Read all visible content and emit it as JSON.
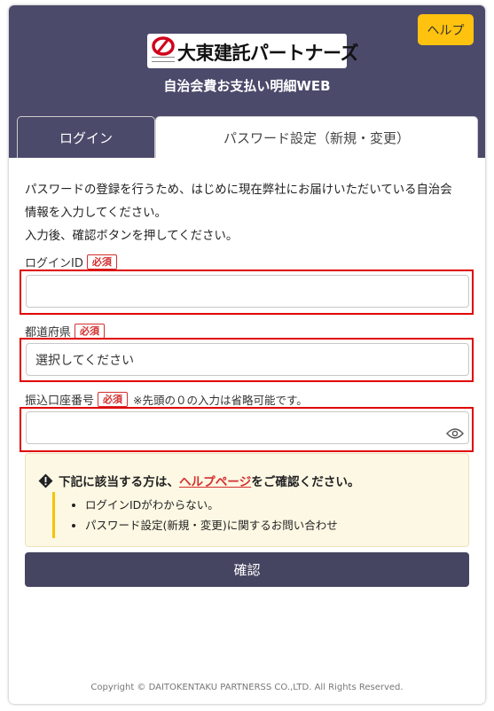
{
  "header": {
    "help_label": "ヘルプ",
    "logo_text": "大東建託パートナーズ",
    "app_title": "自治会費お支払い明細WEB"
  },
  "tabs": {
    "login": "ログイン",
    "password": "パスワード設定（新規・変更）"
  },
  "intro": {
    "line1": "パスワードの登録を行うため、はじめに現在弊社にお届けいただいている自治会",
    "line2": "情報を入力してください。",
    "line3": "入力後、確認ボタンを押してください。"
  },
  "form": {
    "login_id_label": "ログインID",
    "required_badge": "必須",
    "login_id_value": "",
    "prefecture_label": "都道府県",
    "prefecture_value": "選択してください",
    "account_label": "振込口座番号",
    "account_note": "※先頭の０の入力は省略可能です。",
    "account_value": ""
  },
  "info": {
    "prefix": "下記に該当する方は、",
    "link": "ヘルプページ",
    "suffix": "をご確認ください。",
    "items": [
      "ログインIDがわからない。",
      "パスワード設定(新規・変更)に関するお問い合わせ"
    ]
  },
  "submit_label": "確認",
  "footer": "Copyright © DAITOKENTAKU PARTNERSS CO.,LTD. All Rights Reserved.",
  "colors": {
    "header_bg": "#4b4a6b",
    "help_button": "#ffc20e",
    "required_red": "#d32f2f",
    "highlight_red": "#e00000",
    "submit_bg": "#454461",
    "info_bg": "#fdf8e4"
  },
  "icons": {
    "help": "none",
    "logo_mark": "brand-logo-mark",
    "warning": "exclamation-diamond-icon",
    "password_toggle": "eye-icon"
  }
}
